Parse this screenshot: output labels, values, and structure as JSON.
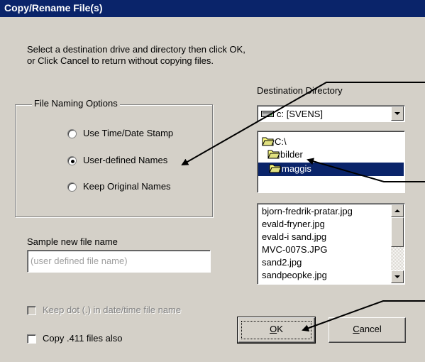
{
  "window": {
    "title": "Copy/Rename File(s)"
  },
  "instructions": {
    "line1": "Select a destination drive and directory then click OK,",
    "line2": "or Click Cancel to return without copying files."
  },
  "naming_options": {
    "label": "File Naming Options",
    "options": [
      {
        "label": "Use Time/Date Stamp",
        "selected": false
      },
      {
        "label": "User-defined Names",
        "selected": true
      },
      {
        "label": "Keep Original Names",
        "selected": false
      }
    ]
  },
  "sample": {
    "label": "Sample new file name",
    "placeholder": "(user defined file name)"
  },
  "destination": {
    "label": "Destination Directory",
    "drive": "c: [SVENS]",
    "folders": [
      "C:\\",
      "bilder",
      "maggis"
    ],
    "selected_folder": "maggis"
  },
  "files": [
    "bjorn-fredrik-pratar.jpg",
    "evald-fryner.jpg",
    "evald-i sand.jpg",
    "MVC-007S.JPG",
    "sand2.jpg",
    "sandpeopke.jpg"
  ],
  "checkboxes": {
    "keep_dot": {
      "label": "Keep dot (.) in date/time file name",
      "checked": false,
      "enabled": false
    },
    "copy_411": {
      "label": "Copy .411 files also",
      "checked": false,
      "enabled": true
    }
  },
  "buttons": {
    "ok_mnemonic": "O",
    "ok_rest": "K",
    "cancel_mnemonic": "C",
    "cancel_rest": "ancel"
  },
  "colors": {
    "title_bar": "#0a246a",
    "face": "#d4d0c8",
    "selection": "#0a246a"
  }
}
